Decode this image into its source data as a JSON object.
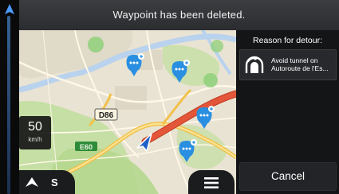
{
  "notification": {
    "text": "Waypoint has been deleted."
  },
  "map": {
    "road_label": "D86",
    "road_label_2": "E60",
    "speed_limit": {
      "value": "50",
      "unit": "km/h"
    },
    "compass_direction": "S"
  },
  "detour_panel": {
    "title": "Reason for detour:",
    "reason_line1": "Avoid tunnel on",
    "reason_line2": "Autoroute de l'Es...",
    "cancel_label": "Cancel"
  },
  "colors": {
    "map_base": "#e9e3d3",
    "park": "#c5dfa4",
    "water": "#b9d2ee",
    "route": "#e4563a",
    "poi": "#2a8fe0",
    "poi_green": "#8fd07a",
    "panel_bg": "#141516",
    "bar_bg": "#2f3134"
  },
  "icons": [
    "navigate-arrow-icon",
    "compass-arrow-icon",
    "menu-icon",
    "tunnel-detour-icon",
    "map-poi-icon"
  ]
}
